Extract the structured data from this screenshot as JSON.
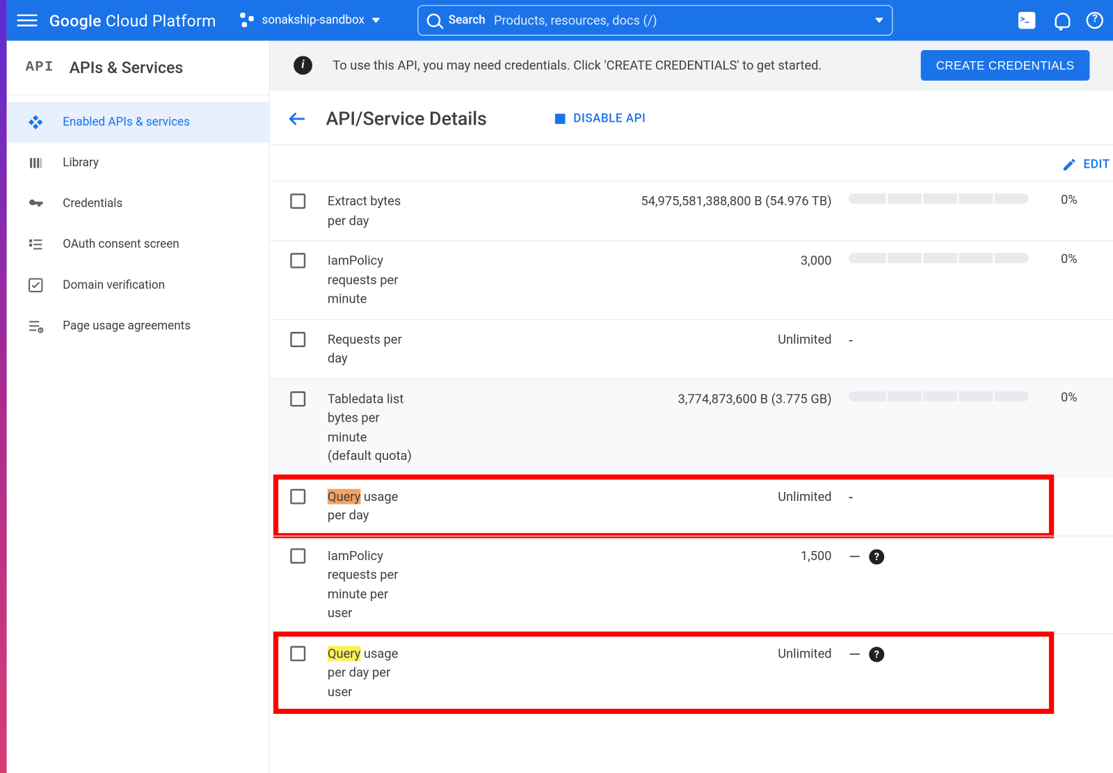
{
  "header": {
    "brand_a": "Google",
    "brand_b": "Cloud Platform",
    "project": "sonakship-sandbox",
    "search_label": "Search",
    "search_placeholder": "Products, resources, docs (/)"
  },
  "sidebar": {
    "section_title": "APIs & Services",
    "items": [
      {
        "label": "Enabled APIs & services",
        "icon": "diamond",
        "active": true
      },
      {
        "label": "Library",
        "icon": "library",
        "active": false
      },
      {
        "label": "Credentials",
        "icon": "key",
        "active": false
      },
      {
        "label": "OAuth consent screen",
        "icon": "consent",
        "active": false
      },
      {
        "label": "Domain verification",
        "icon": "check",
        "active": false
      },
      {
        "label": "Page usage agreements",
        "icon": "agree",
        "active": false
      }
    ]
  },
  "banner": {
    "text": "To use this API, you may need credentials. Click 'CREATE CREDENTIALS' to get started.",
    "button": "CREATE CREDENTIALS"
  },
  "page": {
    "title": "API/Service Details",
    "disable_label": "DISABLE API",
    "edit_label": "EDIT"
  },
  "quota_rows": [
    {
      "name_pre": "",
      "name_hl": "",
      "name_post": "Extract bytes per day",
      "hl": "",
      "limit": "54,975,581,388,800 B (54.976 TB)",
      "bar": true,
      "pct": "0%",
      "shaded": false,
      "redbox": false
    },
    {
      "name_pre": "",
      "name_hl": "",
      "name_post": "IamPolicy requests per minute",
      "hl": "",
      "limit": "3,000",
      "bar": true,
      "pct": "0%",
      "shaded": false,
      "redbox": false
    },
    {
      "name_pre": "",
      "name_hl": "",
      "name_post": "Requests per day",
      "hl": "",
      "limit": "Unlimited",
      "bar": false,
      "pct": "-",
      "shaded": false,
      "redbox": false
    },
    {
      "name_pre": "",
      "name_hl": "",
      "name_post": "Tabledata list bytes per minute (default quota)",
      "hl": "",
      "limit": "3,774,873,600 B (3.775 GB)",
      "bar": true,
      "pct": "0%",
      "shaded": true,
      "redbox": false
    },
    {
      "name_pre": "",
      "name_hl": "Query",
      "name_post": " usage per day",
      "hl": "o",
      "limit": "Unlimited",
      "bar": false,
      "pct": "-",
      "shaded": false,
      "redbox": true
    },
    {
      "name_pre": "",
      "name_hl": "",
      "name_post": "IamPolicy requests per minute per user",
      "hl": "",
      "limit": "1,500",
      "bar": false,
      "pct": "-?",
      "shaded": false,
      "redbox": false
    },
    {
      "name_pre": "",
      "name_hl": "Query",
      "name_post": " usage per day per user",
      "hl": "y",
      "limit": "Unlimited",
      "bar": false,
      "pct": "-?",
      "shaded": false,
      "redbox": true
    }
  ]
}
